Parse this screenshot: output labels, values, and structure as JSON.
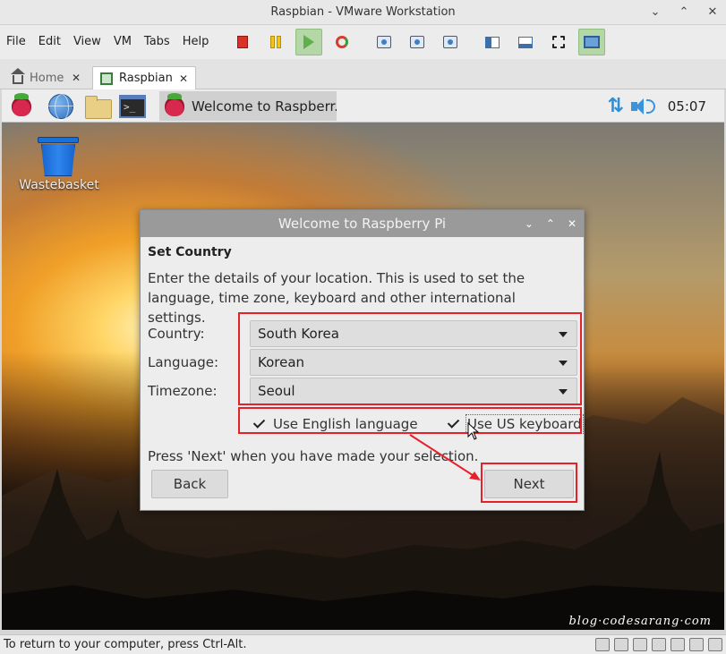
{
  "window": {
    "title": "Raspbian - VMware Workstation",
    "minimize": "⌄",
    "maximize": "⌃",
    "close": "✕"
  },
  "menu": [
    "File",
    "Edit",
    "View",
    "VM",
    "Tabs",
    "Help"
  ],
  "toolbar_icons": [
    "power-off-icon",
    "suspend-icon",
    "power-on-icon",
    "reset-icon",
    "snapshot-icon",
    "revert-snapshot-icon",
    "manage-snapshots-icon",
    "library-view-icon",
    "thumbnail-view-icon",
    "fullscreen-icon",
    "unity-icon"
  ],
  "tabs": [
    {
      "label": "Home",
      "close": "✕"
    },
    {
      "label": "Raspbian",
      "close": "✕"
    }
  ],
  "guest_panel": {
    "task_label": "Welcome to Raspberr...",
    "clock": "05:07",
    "terminal_glyph": ">_"
  },
  "desktop": {
    "wastebasket_label": "Wastebasket",
    "watermark": "blog·codesarang·com"
  },
  "dialog": {
    "title": "Welcome to Raspberry Pi",
    "title_buttons": {
      "minimize": "⌄",
      "maximize": "⌃",
      "close": "✕"
    },
    "section_title": "Set Country",
    "description": "Enter the details of your location. This is used to set the language, time zone, keyboard and other international settings.",
    "fields": {
      "country": {
        "label": "Country:",
        "value": "South Korea"
      },
      "language": {
        "label": "Language:",
        "value": "Korean"
      },
      "timezone": {
        "label": "Timezone:",
        "value": "Seoul"
      }
    },
    "checkboxes": {
      "english": {
        "label": "Use English language",
        "checked": true
      },
      "us_keyboard": {
        "label": "Use US keyboard",
        "checked": true
      }
    },
    "hint": "Press 'Next' when you have made your selection.",
    "back_label": "Back",
    "next_label": "Next"
  },
  "annotation_color": "#e8202a",
  "statusbar": {
    "message": "To return to your computer, press Ctrl-Alt."
  }
}
